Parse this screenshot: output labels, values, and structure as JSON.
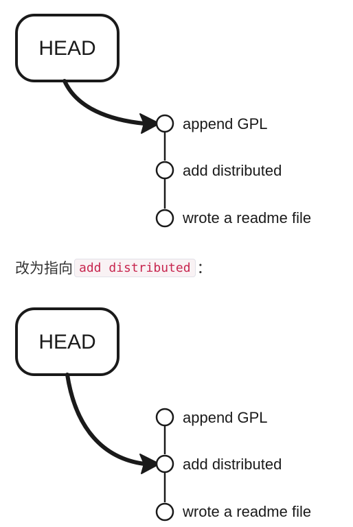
{
  "diagrams": [
    {
      "head_label": "HEAD",
      "commits": [
        "append GPL",
        "add distributed",
        "wrote a readme file"
      ],
      "head_points_to": "append GPL"
    },
    {
      "head_label": "HEAD",
      "commits": [
        "append GPL",
        "add distributed",
        "wrote a readme file"
      ],
      "head_points_to": "add distributed"
    }
  ],
  "caption": {
    "text_before": "改为指向",
    "code": "add distributed",
    "text_after": "："
  },
  "colors": {
    "ink": "#1a1a1a",
    "code_text": "#c7254e",
    "code_bg": "#f9f2f4",
    "code_border": "#e1e1e8",
    "caption_text": "#333333"
  }
}
